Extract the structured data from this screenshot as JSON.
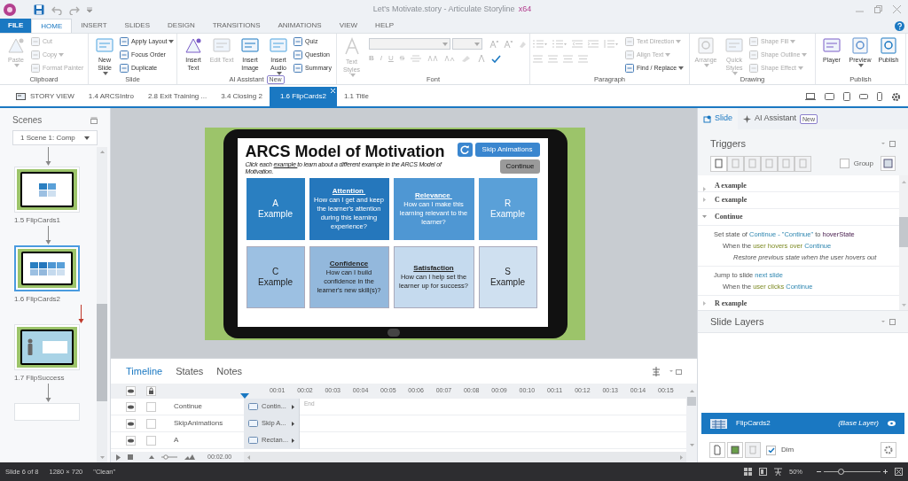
{
  "title_bar": {
    "title": "Let's Motivate.story - Articulate Storyline",
    "edition": "x64"
  },
  "menu_tabs": [
    {
      "label": "FILE",
      "kind": "file",
      "selected": false
    },
    {
      "label": "HOME",
      "kind": "tab",
      "selected": true
    },
    {
      "label": "INSERT",
      "kind": "tab",
      "selected": false
    },
    {
      "label": "SLIDES",
      "kind": "tab",
      "selected": false
    },
    {
      "label": "DESIGN",
      "kind": "tab",
      "selected": false
    },
    {
      "label": "TRANSITIONS",
      "kind": "tab",
      "selected": false
    },
    {
      "label": "ANIMATIONS",
      "kind": "tab",
      "selected": false
    },
    {
      "label": "VIEW",
      "kind": "tab",
      "selected": false
    },
    {
      "label": "HELP",
      "kind": "tab",
      "selected": false
    }
  ],
  "ribbon": [
    {
      "name": "Clipboard",
      "kind": "standard",
      "buttons": [
        {
          "label": "Paste",
          "kind": "large",
          "disabled": true,
          "dropdown": true
        },
        {
          "label": "Cut",
          "kind": "small",
          "disabled": true,
          "dropdown": false
        },
        {
          "label": "Copy",
          "kind": "small",
          "disabled": true,
          "dropdown": true
        },
        {
          "label": "Format Painter",
          "kind": "small",
          "disabled": true,
          "dropdown": false
        }
      ]
    },
    {
      "name": "Slide",
      "kind": "standard",
      "buttons": [
        {
          "label": "New Slide",
          "kind": "large",
          "disabled": false,
          "dropdown": true
        },
        {
          "label": "Apply Layout",
          "kind": "small",
          "disabled": false,
          "dropdown": true
        },
        {
          "label": "Focus Order",
          "kind": "small",
          "disabled": false,
          "dropdown": false
        },
        {
          "label": "Duplicate",
          "kind": "small",
          "disabled": false,
          "dropdown": false
        }
      ]
    },
    {
      "name": "AI Assistant",
      "badge": "New",
      "kind": "standard",
      "buttons": [
        {
          "label": "Insert Text",
          "kind": "large",
          "disabled": false,
          "dropdown": false
        },
        {
          "label": "Edit Text",
          "kind": "large",
          "disabled": true,
          "dropdown": false
        },
        {
          "label": "Insert Image",
          "kind": "large",
          "disabled": false,
          "dropdown": false
        },
        {
          "label": "Insert Audio",
          "kind": "large",
          "disabled": false,
          "dropdown": true
        },
        {
          "label": "Quiz",
          "kind": "small",
          "disabled": false,
          "dropdown": false
        },
        {
          "label": "Question",
          "kind": "small",
          "disabled": false,
          "dropdown": false
        },
        {
          "label": "Summary",
          "kind": "small",
          "disabled": false,
          "dropdown": false
        }
      ]
    },
    {
      "name": "Font",
      "kind": "font",
      "buttons": [
        {
          "label": "Text Styles",
          "kind": "large",
          "disabled": true,
          "dropdown": true
        }
      ],
      "format_buttons": [
        "B",
        "I",
        "U",
        "S"
      ]
    },
    {
      "name": "Paragraph",
      "kind": "paragraph",
      "buttons": [
        {
          "label": "Text Direction",
          "kind": "small",
          "disabled": true,
          "dropdown": true
        },
        {
          "label": "Align Text",
          "kind": "small",
          "disabled": true,
          "dropdown": true
        },
        {
          "label": "Find / Replace",
          "kind": "small",
          "disabled": false,
          "dropdown": true
        }
      ]
    },
    {
      "name": "Drawing",
      "kind": "standard",
      "buttons": [
        {
          "label": "Arrange",
          "kind": "large",
          "disabled": true,
          "dropdown": true
        },
        {
          "label": "Quick Styles",
          "kind": "large",
          "disabled": true,
          "dropdown": true
        },
        {
          "label": "Shape Fill",
          "kind": "small",
          "disabled": true,
          "dropdown": true
        },
        {
          "label": "Shape Outline",
          "kind": "small",
          "disabled": true,
          "dropdown": true
        },
        {
          "label": "Shape Effect",
          "kind": "small",
          "disabled": true,
          "dropdown": true
        }
      ]
    },
    {
      "name": "Publish",
      "kind": "standard",
      "buttons": [
        {
          "label": "Player",
          "kind": "large",
          "disabled": false,
          "dropdown": false
        },
        {
          "label": "Preview",
          "kind": "large",
          "disabled": false,
          "dropdown": true
        },
        {
          "label": "Publish",
          "kind": "large",
          "disabled": false,
          "dropdown": false
        }
      ]
    }
  ],
  "slide_tabs": [
    {
      "label": "STORY VIEW",
      "kind": "story",
      "selected": false
    },
    {
      "label": "1.4 ARCSIntro",
      "kind": "slide",
      "selected": false
    },
    {
      "label": "2.8 Exit Training ...",
      "kind": "slide",
      "selected": false
    },
    {
      "label": "3.4 Closing 2",
      "kind": "slide",
      "selected": false
    },
    {
      "label": "1.6 FlipCards2",
      "kind": "slide",
      "selected": true
    },
    {
      "label": "1.1 Title",
      "kind": "slide",
      "selected": false
    }
  ],
  "scenes": {
    "title": "Scenes",
    "scene_select": "1 Scene 1: Comp",
    "slides": [
      {
        "label": "1.5 FlipCards1",
        "kind": "cards",
        "branch": false,
        "selected": false
      },
      {
        "label": "1.6 FlipCards2",
        "kind": "grid",
        "branch": false,
        "selected": true
      },
      {
        "label": "1.7 FlipSuccess",
        "kind": "character",
        "branch": true,
        "selected": false
      }
    ]
  },
  "slide": {
    "title": "ARCS Model of Motivation",
    "skip_button": "Skip Animations",
    "continue_button": "Continue",
    "instruction": [
      {
        "text": "Click each ",
        "underline": false
      },
      {
        "text": "example ",
        "underline": true
      },
      {
        "text": "to learn about a different example in the ARCS Model of Motivation.",
        "underline": false
      }
    ],
    "cards": [
      {
        "kind": "letter",
        "title": "A",
        "text": "Example",
        "color": "#2a7fc1"
      },
      {
        "kind": "info",
        "title": "Attention ",
        "text": "How can I get and keep the learner's attention during this learning experience?",
        "color": "#2577bc"
      },
      {
        "kind": "info",
        "title": "Relevance ",
        "text": "How can I make this learning relevant to the learner?",
        "color": "#4f97d3"
      },
      {
        "kind": "letter",
        "title": "R",
        "text": "Example",
        "color": "#5aa0d8"
      },
      {
        "kind": "letter",
        "title": "C",
        "text": "Example",
        "color": "#9cc0e2"
      },
      {
        "kind": "info",
        "title": "Confidence",
        "text": "How can I build confidence in the learner's new skill(s)?",
        "color": "#93b8dc"
      },
      {
        "kind": "info",
        "title": "Satisfaction",
        "text": "How can I help set the learner up for success?",
        "color": "#c5daee"
      },
      {
        "kind": "letter",
        "title": "S",
        "text": "Example",
        "color": "#cfe0f0"
      }
    ]
  },
  "timeline": {
    "tabs": [
      {
        "label": "Timeline",
        "selected": true
      },
      {
        "label": "States",
        "selected": false
      },
      {
        "label": "Notes",
        "selected": false
      }
    ],
    "ruler": [
      "00:01",
      "00:02",
      "00:03",
      "00:04",
      "00:05",
      "00:06",
      "00:07",
      "00:08",
      "00:09",
      "00:10",
      "00:11",
      "00:12",
      "00:13",
      "00:14",
      "00:15"
    ],
    "end_label": "End",
    "rows": [
      {
        "name": "Continue",
        "bar": "Contin...",
        "locked": false
      },
      {
        "name": "SkipAnimations",
        "bar": "Skip A...",
        "locked": false
      },
      {
        "name": "A",
        "bar": "Rectan...",
        "locked": false
      }
    ],
    "duration": "00:02.00"
  },
  "right_panel": {
    "tabs": [
      {
        "label": "Slide",
        "selected": true
      },
      {
        "label": "AI Assistant",
        "badge": "New",
        "selected": false
      }
    ],
    "triggers_title": "Triggers",
    "group_label": "Group",
    "group_checked": false,
    "triggers": [
      {
        "kind": "group",
        "label": "A example",
        "expanded": false
      },
      {
        "kind": "group",
        "label": "C example",
        "expanded": false
      },
      {
        "kind": "group",
        "label": "Continue",
        "expanded": true
      },
      {
        "kind": "action",
        "lines": [
          {
            "kind": "action",
            "parts": [
              {
                "text": "Set state of ",
                "kind": "plain"
              },
              {
                "text": "Continue - \"Continue\"",
                "kind": "object"
              },
              {
                "text": " to ",
                "kind": "plain"
              },
              {
                "text": "hoverState",
                "kind": "value"
              }
            ]
          },
          {
            "kind": "condition",
            "parts": [
              {
                "text": "When the ",
                "kind": "plain"
              },
              {
                "text": "user hovers over",
                "kind": "event"
              },
              {
                "text": " Continue",
                "kind": "object"
              }
            ]
          },
          {
            "kind": "note",
            "parts": [
              {
                "text": "Restore previous state when the user hovers out",
                "kind": "plain"
              }
            ]
          }
        ]
      },
      {
        "kind": "action",
        "lines": [
          {
            "kind": "action",
            "parts": [
              {
                "text": "Jump to slide ",
                "kind": "plain"
              },
              {
                "text": "next slide",
                "kind": "object"
              }
            ]
          },
          {
            "kind": "condition",
            "parts": [
              {
                "text": "When the ",
                "kind": "plain"
              },
              {
                "text": "user clicks",
                "kind": "event"
              },
              {
                "text": " Continue",
                "kind": "object"
              }
            ]
          }
        ]
      },
      {
        "kind": "group",
        "label": "R example",
        "expanded": false
      }
    ],
    "layers_title": "Slide Layers",
    "layers": [
      {
        "name": "FlipCards2",
        "note": "(Base Layer)",
        "selected": true
      }
    ],
    "dim_label": "Dim",
    "dim_checked": true
  },
  "status_bar": {
    "slide": "Slide 6 of 8",
    "size": "1280 × 720",
    "theme": "\"Clean\"",
    "zoom": "50%",
    "zoom_slider": {
      "level": 0.3
    }
  }
}
